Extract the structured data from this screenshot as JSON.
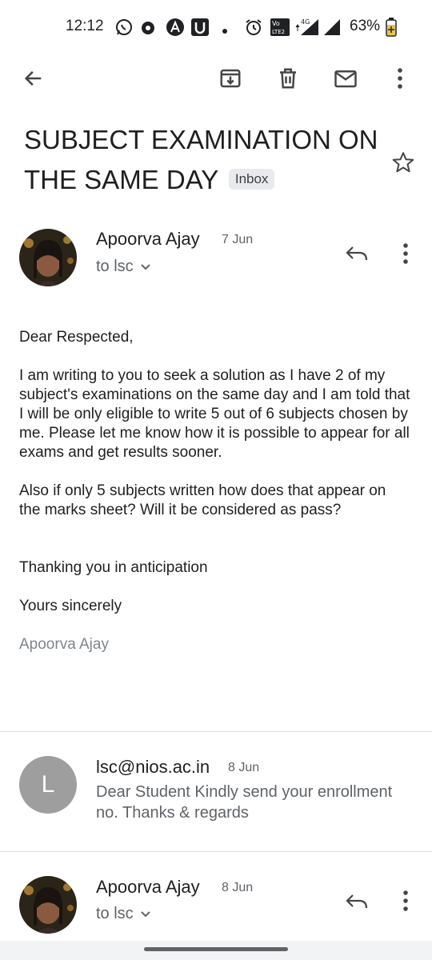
{
  "status_bar": {
    "time": "12:12",
    "battery": "63%",
    "icons": [
      "whatsapp-icon",
      "app-icon",
      "a-icon",
      "u-icon",
      "dot-icon",
      "alarm-icon",
      "volte-icon",
      "4g-icon",
      "signal-icon",
      "signal2-icon",
      "battery-icon"
    ]
  },
  "toolbar": {
    "icons": [
      "back-arrow-icon",
      "archive-icon",
      "delete-icon",
      "mark-unread-icon",
      "more-vert-icon"
    ]
  },
  "subject": {
    "text": "SUBJECT EXAMINATION ON THE SAME DAY",
    "label": "Inbox"
  },
  "message1": {
    "sender": "Apoorva Ajay",
    "date": "7 Jun",
    "to": "to lsc",
    "body": [
      "Dear Respected,",
      "I am writing to you to seek a solution as I have 2 of my subject's examinations on the same day and I am told that I will be only eligible to write 5 out of 6 subjects chosen by me. Please let me know how it is possible to appear for all exams and get results sooner.",
      "Also if only 5 subjects written how does that appear on the marks sheet? Will it be considered as pass?",
      "Thanking you in anticipation",
      "Yours sincerely"
    ],
    "signature": "Apoorva Ajay"
  },
  "message2": {
    "avatar_letter": "L",
    "sender": "lsc@nios.ac.in",
    "date": "8 Jun",
    "snippet": "Dear Student Kindly send your enrollment no. Thanks & regards"
  },
  "message3": {
    "sender": "Apoorva Ajay",
    "date": "8 Jun",
    "to": "to lsc"
  }
}
